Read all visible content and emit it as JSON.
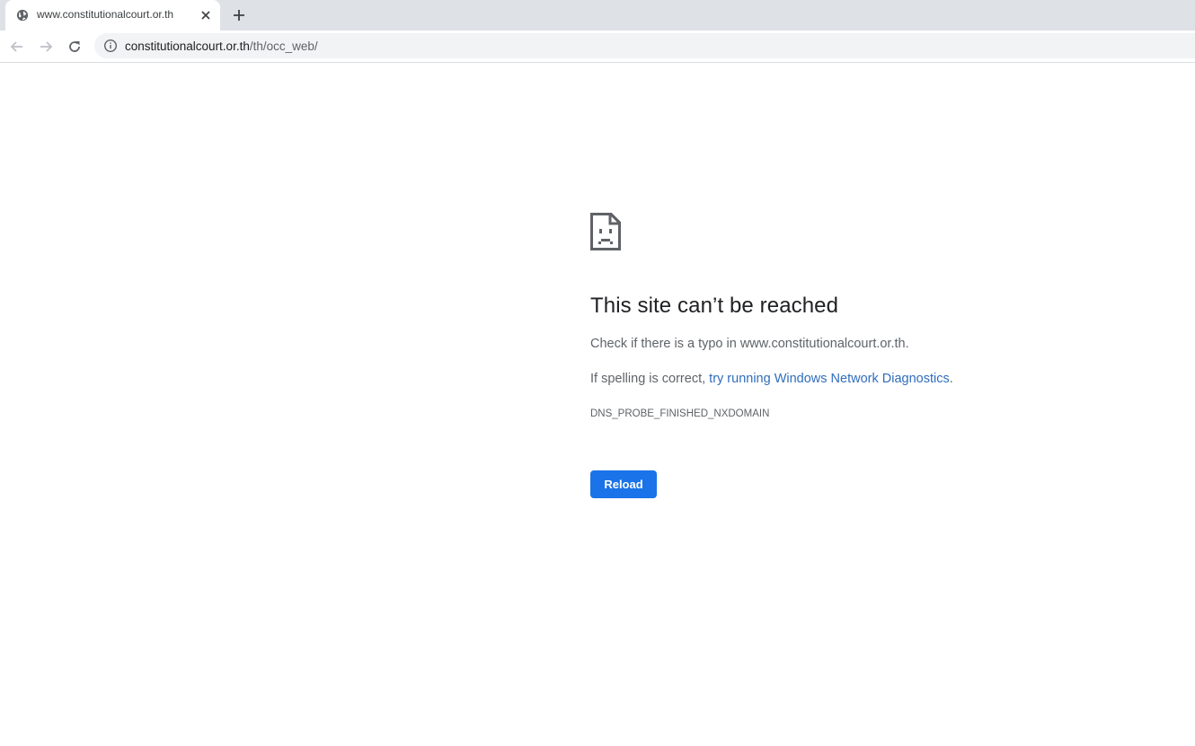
{
  "tab": {
    "title": "www.constitutionalcourt.or.th",
    "favicon": "globe-icon",
    "close": "close-icon"
  },
  "new_tab": "plus-icon",
  "toolbar": {
    "back": "back-arrow-icon",
    "forward": "forward-arrow-icon",
    "reload": "reload-icon",
    "site_info": "info-icon",
    "url_host": "constitutionalcourt.or.th",
    "url_path": "/th/occ_web/"
  },
  "error": {
    "icon": "sad-page-icon",
    "heading": "This site can’t be reached",
    "typo_text": "Check if there is a typo in www.constitutionalcourt.or.th.",
    "spelling_prefix": "If spelling is correct, ",
    "diagnostics_link": "try running Windows Network Diagnostics",
    "spelling_suffix": ".",
    "error_code": "DNS_PROBE_FINISHED_NXDOMAIN",
    "reload_label": "Reload"
  },
  "colors": {
    "accent": "#1a73e8",
    "link": "#2f6dbd",
    "tabstrip": "#dee1e6",
    "omnibox": "#f1f3f4"
  }
}
